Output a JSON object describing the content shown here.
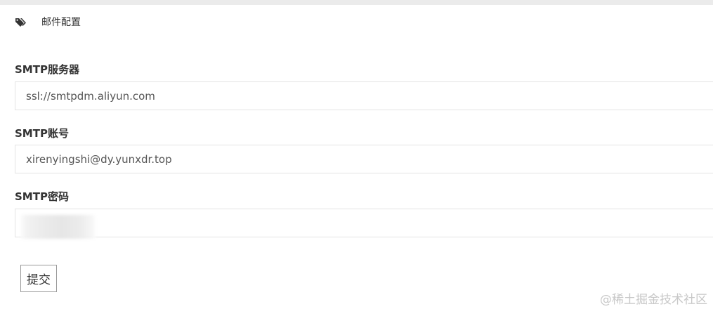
{
  "header": {
    "icon": "tags-icon",
    "title": "邮件配置"
  },
  "form": {
    "fields": [
      {
        "label": "SMTP服务器",
        "value": "ssl://smtpdm.aliyun.com"
      },
      {
        "label": "SMTP账号",
        "value": "xirenyingshi@dy.yunxdr.top"
      },
      {
        "label": "SMTP密码",
        "value": ""
      }
    ],
    "submit_label": "提交"
  },
  "watermark": "@稀土掘金技术社区",
  "colors": {
    "top_strip": "#ebebeb",
    "border": "#e3e3e3",
    "text": "#333333"
  }
}
